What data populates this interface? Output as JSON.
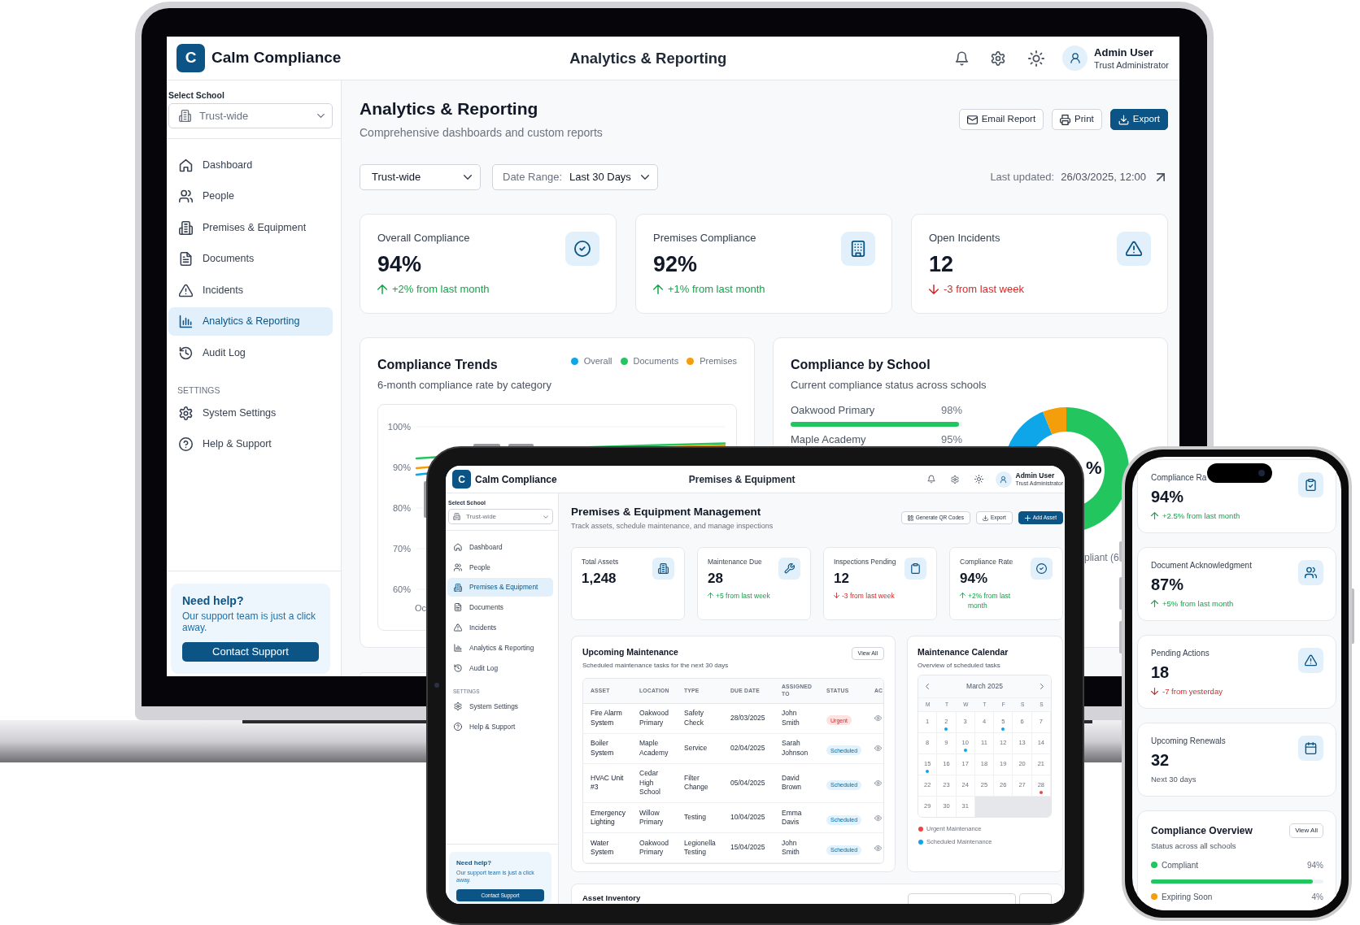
{
  "laptop": {
    "header": {
      "logo": "C",
      "brand": "Calm Compliance",
      "title": "Analytics & Reporting",
      "user_name": "Admin User",
      "user_role": "Trust Administrator"
    },
    "sidebar": {
      "school_label": "Select School",
      "school": "Trust-wide",
      "nav": [
        {
          "label": "Dashboard",
          "selected": false
        },
        {
          "label": "People",
          "selected": false
        },
        {
          "label": "Premises & Equipment",
          "selected": false
        },
        {
          "label": "Documents",
          "selected": false
        },
        {
          "label": "Incidents",
          "selected": false
        },
        {
          "label": "Analytics & Reporting",
          "selected": true
        },
        {
          "label": "Audit Log",
          "selected": false
        }
      ],
      "settings_heading": "SETTINGS",
      "settings": [
        {
          "label": "System Settings",
          "selected": false
        },
        {
          "label": "Help & Support",
          "selected": false
        }
      ],
      "help": {
        "title": "Need help?",
        "text": "Our support team is just a click away.",
        "button": "Contact Support"
      }
    },
    "page": {
      "title": "Analytics & Reporting",
      "subtitle": "Comprehensive dashboards and custom reports",
      "actions": [
        {
          "label": "Email Report",
          "primary": false
        },
        {
          "label": "Print",
          "primary": false
        },
        {
          "label": "Export",
          "primary": true
        }
      ],
      "school_filter": "Trust-wide",
      "date_range": {
        "label": "Date Range:",
        "value": "Last 30 Days"
      },
      "last_updated": {
        "label": "Last updated:",
        "value": "26/03/2025, 12:00"
      },
      "stats": [
        {
          "label": "Overall Compliance",
          "value": "94%",
          "change": "+2% from last month",
          "rising": true
        },
        {
          "label": "Premises Compliance",
          "value": "92%",
          "change": "+1% from last month",
          "rising": true
        },
        {
          "label": "Open Incidents",
          "value": "12",
          "change": "-3 from last week",
          "rising": false
        }
      ]
    },
    "trends": {
      "title": "Compliance Trends",
      "subtitle": "6-month compliance rate by category",
      "legend": [
        {
          "label": "Overall",
          "color": "#0ea5e9"
        },
        {
          "label": "Documents",
          "color": "#22c55e"
        },
        {
          "label": "Premises",
          "color": "#f59e0b"
        }
      ],
      "y_labels": [
        "100%",
        "90%",
        "80%",
        "70%",
        "60%"
      ],
      "x_label": "Oc"
    },
    "by_school": {
      "title": "Compliance by School",
      "subtitle": "Current compliance status across schools",
      "schools": [
        {
          "name": "Oakwood Primary",
          "value": "98%",
          "level": 0.98
        },
        {
          "name": "Maple Academy",
          "value": "95%"
        }
      ],
      "donut_label": "%",
      "legend_text": "pliant (6"
    }
  },
  "tablet": {
    "header": {
      "logo": "C",
      "brand": "Calm Compliance",
      "title": "Premises & Equipment",
      "user_name": "Admin User",
      "user_role": "Trust Administrator"
    },
    "sidebar": {
      "school_label": "Select School",
      "school": "Trust-wide",
      "nav": [
        {
          "label": "Dashboard",
          "selected": false
        },
        {
          "label": "People",
          "selected": false
        },
        {
          "label": "Premises & Equipment",
          "selected": true
        },
        {
          "label": "Documents",
          "selected": false
        },
        {
          "label": "Incidents",
          "selected": false
        },
        {
          "label": "Analytics & Reporting",
          "selected": false
        },
        {
          "label": "Audit Log",
          "selected": false
        }
      ],
      "settings_heading": "SETTINGS",
      "settings": [
        {
          "label": "System Settings",
          "selected": false
        },
        {
          "label": "Help & Support",
          "selected": false
        }
      ],
      "help": {
        "title": "Need help?",
        "text": "Our support team is just a click away.",
        "button": "Contact Support"
      }
    },
    "page": {
      "title": "Premises & Equipment Management",
      "subtitle": "Track assets, schedule maintenance, and manage inspections",
      "actions": [
        {
          "label": "Generate QR Codes",
          "primary": false
        },
        {
          "label": "Export",
          "primary": false
        },
        {
          "label": "Add Asset",
          "primary": true
        }
      ],
      "stats": [
        {
          "label": "Total Assets",
          "value": "1,248"
        },
        {
          "label": "Maintenance Due",
          "value": "28",
          "change": "+5 from last week",
          "rising": true
        },
        {
          "label": "Inspections Pending",
          "value": "12",
          "change": "-3 from last week",
          "rising": false
        },
        {
          "label": "Compliance Rate",
          "value": "94%",
          "change": "+2% from last month",
          "rising": true
        }
      ]
    },
    "maintenance": {
      "title": "Upcoming Maintenance",
      "subtitle": "Scheduled maintenance tasks for the next 30 days",
      "button": "View All",
      "columns": [
        "ASSET",
        "LOCATION",
        "TYPE",
        "DUE DATE",
        "ASSIGNED TO",
        "STATUS",
        "AC"
      ],
      "rows": [
        {
          "cells": [
            "Fire Alarm System",
            "Oakwood Primary",
            "Safety Check",
            "28/03/2025",
            "John Smith"
          ],
          "status": {
            "label": "Urgent",
            "kind": "urgent"
          }
        },
        {
          "cells": [
            "Boiler System",
            "Maple Academy",
            "Service",
            "02/04/2025",
            "Sarah Johnson"
          ],
          "status": {
            "label": "Scheduled",
            "kind": "scheduled"
          }
        },
        {
          "cells": [
            "HVAC Unit #3",
            "Cedar High School",
            "Filter Change",
            "05/04/2025",
            "David Brown"
          ],
          "status": {
            "label": "Scheduled",
            "kind": "scheduled"
          }
        },
        {
          "cells": [
            "Emergency Lighting",
            "Willow Primary",
            "Testing",
            "10/04/2025",
            "Emma Davis"
          ],
          "status": {
            "label": "Scheduled",
            "kind": "scheduled"
          }
        },
        {
          "cells": [
            "Water System",
            "Oakwood Primary",
            "Legionella Testing",
            "15/04/2025",
            "John Smith"
          ],
          "status": {
            "label": "Scheduled",
            "kind": "scheduled"
          }
        }
      ]
    },
    "calendar": {
      "title": "Maintenance Calendar",
      "subtitle": "Overview of scheduled tasks",
      "month": "March 2025",
      "weekdays": [
        "M",
        "T",
        "W",
        "T",
        "F",
        "S",
        "S"
      ],
      "days": [
        {
          "label": "1"
        },
        {
          "label": "2",
          "color": "#0ea5e9"
        },
        {
          "label": "3"
        },
        {
          "label": "4"
        },
        {
          "label": "5",
          "color": "#0ea5e9"
        },
        {
          "label": "6"
        },
        {
          "label": "7"
        },
        {
          "label": "8"
        },
        {
          "label": "9"
        },
        {
          "label": "10",
          "color": "#0ea5e9"
        },
        {
          "label": "11"
        },
        {
          "label": "12"
        },
        {
          "label": "13"
        },
        {
          "label": "14"
        },
        {
          "label": "15",
          "color": "#0ea5e9"
        },
        {
          "label": "16"
        },
        {
          "label": "17"
        },
        {
          "label": "18"
        },
        {
          "label": "19"
        },
        {
          "label": "20"
        },
        {
          "label": "21"
        },
        {
          "label": "22"
        },
        {
          "label": "23"
        },
        {
          "label": "24"
        },
        {
          "label": "25"
        },
        {
          "label": "26"
        },
        {
          "label": "27"
        },
        {
          "label": "28",
          "color": "#ef4444"
        },
        {
          "label": "29"
        },
        {
          "label": "30"
        },
        {
          "label": "31"
        }
      ],
      "legend": [
        {
          "label": "Urgent Maintenance",
          "color": "#ef4444"
        },
        {
          "label": "Scheduled Maintenance",
          "color": "#0ea5e9"
        }
      ]
    },
    "inventory": {
      "title": "Asset Inventory"
    }
  },
  "phone": {
    "stats": [
      {
        "label": "Compliance Ra",
        "value": "94%",
        "change": "+2.5% from last month",
        "rising": true
      },
      {
        "label": "Document Acknowledgment",
        "value": "87%",
        "change": "+5% from last month",
        "rising": true
      },
      {
        "label": "Pending Actions",
        "value": "18",
        "change": "-7 from yesterday",
        "rising": false
      },
      {
        "label": "Upcoming Renewals",
        "value": "32",
        "note": "Next 30 days"
      }
    ],
    "overview": {
      "title": "Compliance Overview",
      "button": "View All",
      "subtitle": "Status across all schools",
      "items": [
        {
          "label": "Compliant",
          "value": "94%",
          "color": "#22c55e",
          "level": 0.94
        },
        {
          "label": "Expiring Soon",
          "value": "4%",
          "color": "#f59e0b"
        }
      ]
    }
  }
}
